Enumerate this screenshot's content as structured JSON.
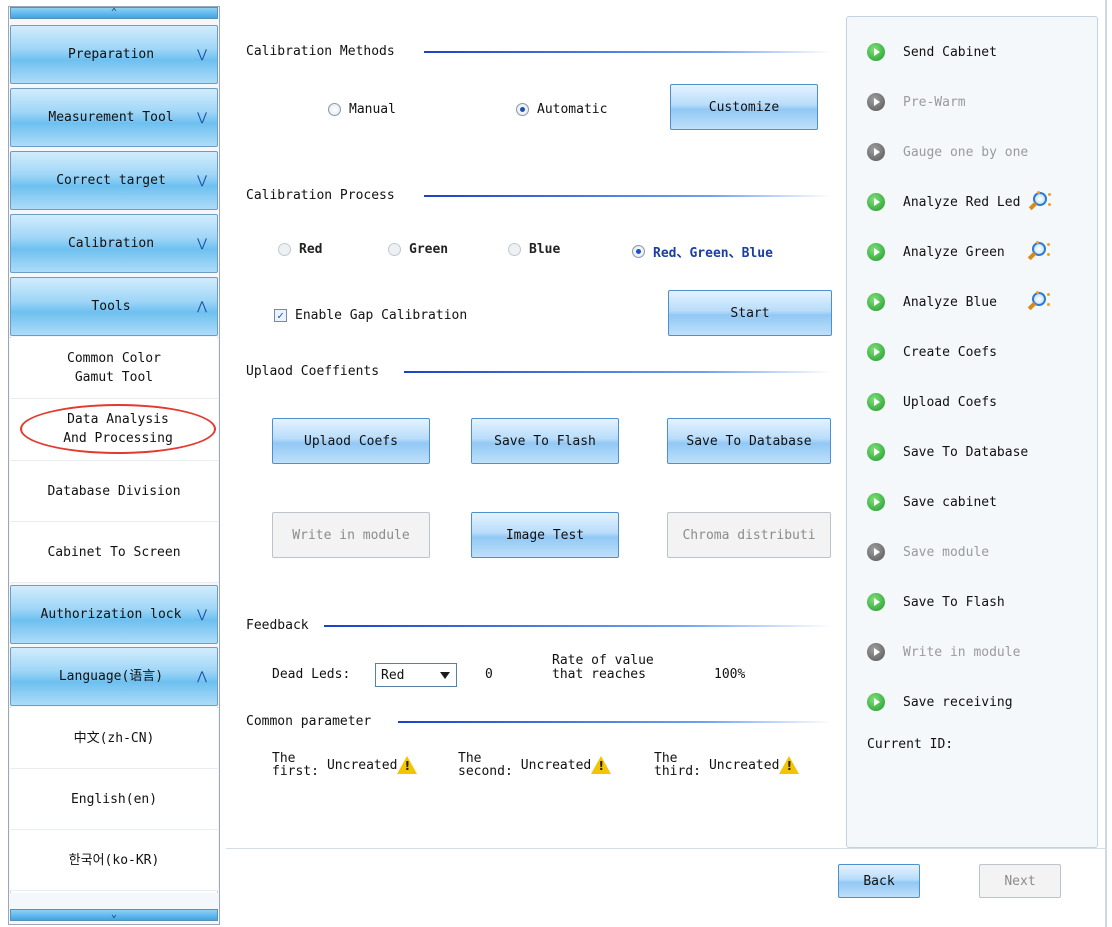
{
  "sidebar": {
    "headers": {
      "preparation": "Preparation",
      "measurement_tool": "Measurement Tool",
      "correct_target": "Correct target",
      "calibration": "Calibration",
      "tools": "Tools",
      "authorization_lock": "Authorization lock",
      "language": "Language(语言)"
    },
    "tools_items": [
      "Common Color\nGamut Tool",
      "Data Analysis\nAnd Processing",
      "Database Division",
      "Cabinet To Screen"
    ],
    "language_items": [
      "中文(zh-CN)",
      "English(en)",
      "한국어(ko-KR)"
    ]
  },
  "calibration_methods": {
    "title": "Calibration Methods",
    "manual": "Manual",
    "automatic": "Automatic",
    "selected": "automatic",
    "customize": "Customize"
  },
  "calibration_process": {
    "title": "Calibration Process",
    "red": "Red",
    "green": "Green",
    "blue": "Blue",
    "rgb": "Red、Green、Blue",
    "enable_gap": "Enable Gap Calibration",
    "enable_gap_checked": true,
    "start": "Start"
  },
  "upload": {
    "title": "Uplaod Coeffients",
    "upload_coefs": "Uplaod Coefs",
    "save_flash": "Save To Flash",
    "save_database": "Save To Database",
    "write_module": "Write in module",
    "image_test": "Image Test",
    "chroma": "Chroma distributi"
  },
  "feedback": {
    "title": "Feedback",
    "dead_leds_label": "Dead Leds:",
    "dead_leds_value": "Red",
    "dead_count": "0",
    "rate_label": "Rate of value\nthat reaches",
    "rate_value": "100%"
  },
  "common_parameter": {
    "title": "Common parameter",
    "first_label": "The\nfirst:",
    "first_value": "Uncreated",
    "second_label": "The\nsecond:",
    "second_value": "Uncreated",
    "third_label": "The\nthird:",
    "third_value": "Uncreated"
  },
  "steps": [
    {
      "label": "Send Cabinet",
      "enabled": true
    },
    {
      "label": "Pre-Warm",
      "enabled": false
    },
    {
      "label": "Gauge one by one",
      "enabled": false
    },
    {
      "label": "Analyze Red Led",
      "enabled": true
    },
    {
      "label": "Analyze Green",
      "enabled": true
    },
    {
      "label": "Analyze Blue",
      "enabled": true
    },
    {
      "label": "Create Coefs",
      "enabled": true
    },
    {
      "label": "Upload Coefs",
      "enabled": true
    },
    {
      "label": "Save To Database",
      "enabled": true
    },
    {
      "label": "Save cabinet",
      "enabled": true
    },
    {
      "label": "Save module",
      "enabled": false
    },
    {
      "label": "Save To Flash",
      "enabled": true
    },
    {
      "label": "Write in module",
      "enabled": false
    },
    {
      "label": "Save receiving",
      "enabled": true
    }
  ],
  "current_id_label": "Current ID:",
  "nav": {
    "back": "Back",
    "next": "Next"
  },
  "colors": {
    "accent_blue": "#1e40c8",
    "highlight_red": "#e23a2f",
    "step_green": "#1e9a28"
  }
}
